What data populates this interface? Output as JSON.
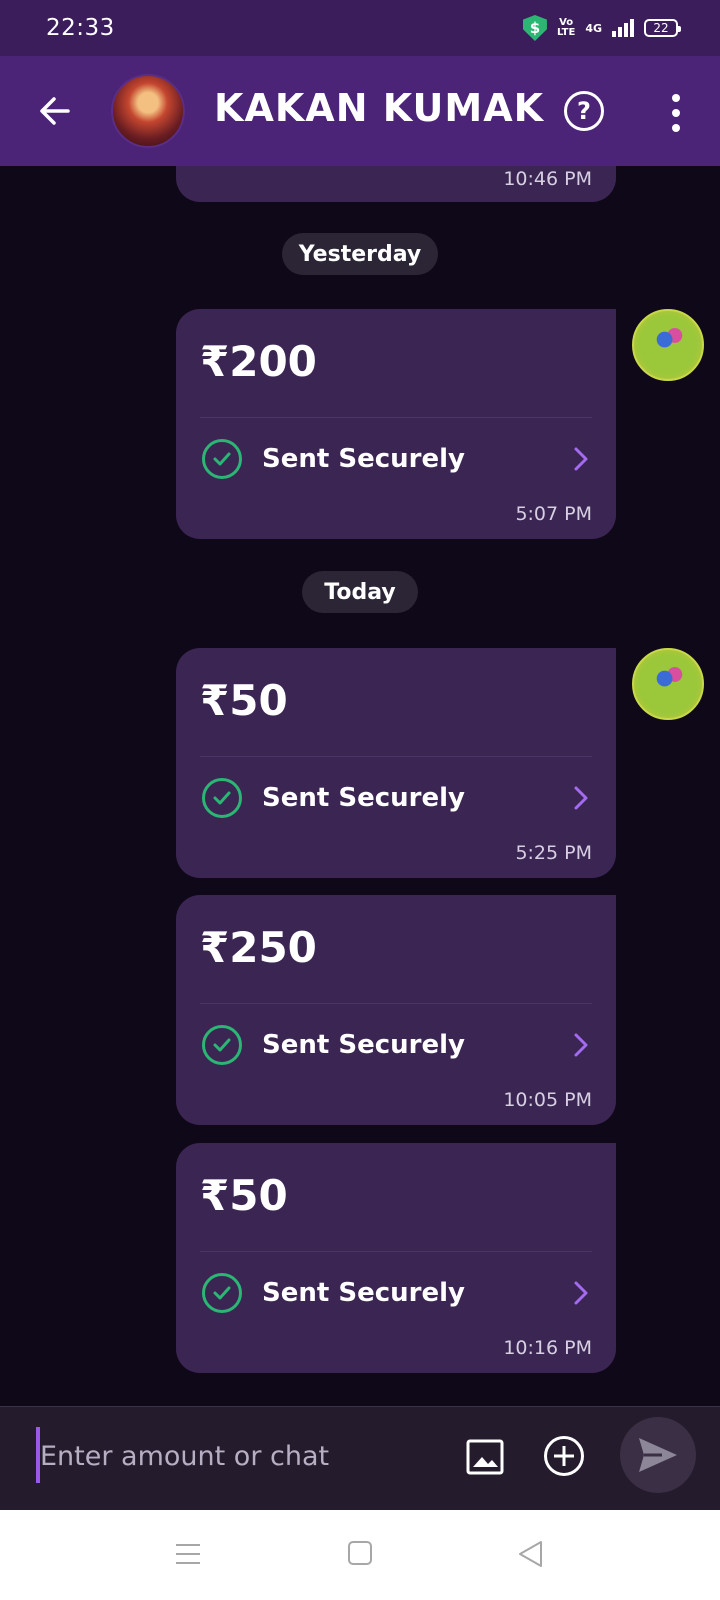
{
  "status_bar": {
    "time": "22:33",
    "volte_top": "Vo",
    "volte_bottom": "LTE",
    "network": "4G",
    "battery": "22"
  },
  "header": {
    "contact_name": "KAKAN KUMAK"
  },
  "chat": {
    "partial_time": "10:46 PM",
    "date_yesterday": "Yesterday",
    "date_today": "Today",
    "messages": [
      {
        "amount": "₹200",
        "status": "Sent Securely",
        "time": "5:07 PM"
      },
      {
        "amount": "₹50",
        "status": "Sent Securely",
        "time": "5:25 PM"
      },
      {
        "amount": "₹250",
        "status": "Sent Securely",
        "time": "10:05 PM"
      },
      {
        "amount": "₹50",
        "status": "Sent Securely",
        "time": "10:16 PM"
      }
    ]
  },
  "composer": {
    "placeholder": "Enter amount or chat"
  },
  "colors": {
    "header": "#4b2377",
    "status_bar": "#3b1d5c",
    "bubble": "#3b2553",
    "success": "#2bb673",
    "chevron": "#a36cf0"
  },
  "icons": [
    "back-arrow-icon",
    "help-icon",
    "more-vertical-icon",
    "check-circle-icon",
    "chevron-right-icon",
    "image-icon",
    "add-circle-icon",
    "send-icon"
  ]
}
